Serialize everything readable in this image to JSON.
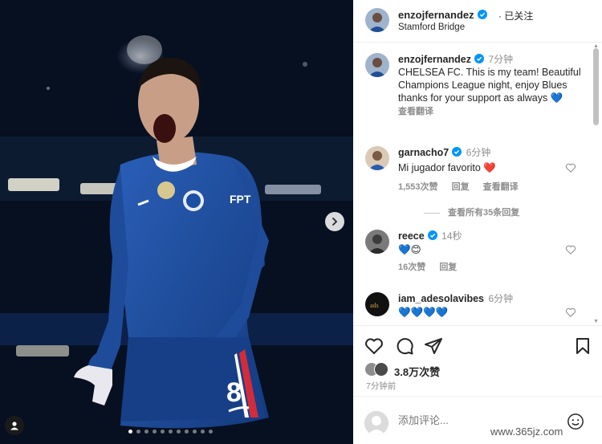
{
  "post": {
    "author": "enzojfernandez",
    "follow_status": "· 已关注",
    "location": "Stamford Bridge",
    "jersey_number": "8",
    "sponsor_text": "FPT",
    "caption_time": "7分钟",
    "caption": "CHELSEA FC. This is my team! Beautiful Champions League night, enjoy Blues thanks for your support as always 💙",
    "see_translation": "查看翻译",
    "likes": "3.8万次赞",
    "posted_ago": "7分钟前"
  },
  "comments": [
    {
      "user": "garnacho7",
      "time": "6分钟",
      "text": "Mi jugador favorito ❤️",
      "likes": "1,553次赞",
      "reply": "回复",
      "translate": "查看翻译",
      "view_replies": "查看所有35条回复"
    },
    {
      "user": "reece",
      "time": "14秒",
      "text": "💙😊",
      "likes": "16次赞",
      "reply": "回复"
    },
    {
      "user": "iam_adesolavibes",
      "time": "6分钟",
      "text": "💙💙💙💙"
    }
  ],
  "composer": {
    "placeholder": "添加评论..."
  },
  "icons": [
    "verified-icon",
    "heart-icon",
    "comment-icon",
    "share-icon",
    "bookmark-icon",
    "emoji-icon",
    "chevron-right-icon",
    "user-tag-icon"
  ],
  "colors": {
    "verified": "#0095f6",
    "chelsea_blue": "#1b4fa3",
    "muted_text": "#8e8e8e"
  },
  "carousel": {
    "slides": 11,
    "active": 1
  },
  "watermark": "www.365jz.com"
}
